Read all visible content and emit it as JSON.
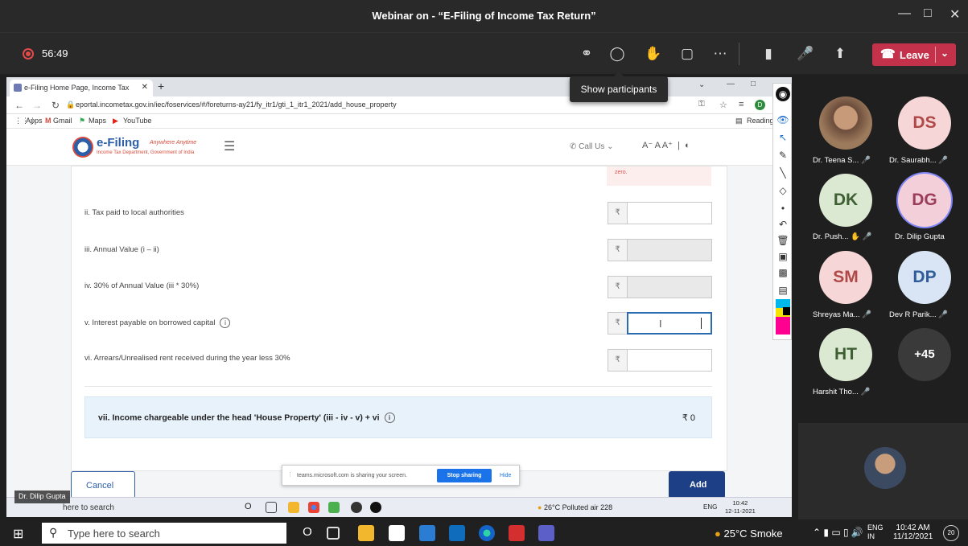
{
  "teams": {
    "window_title": "Webinar on - “E-Filing of Income Tax Return”",
    "timer": "56:49",
    "tooltip": "Show participants",
    "leave_label": "Leave",
    "icons": [
      "participants-icon",
      "chat-icon",
      "raise-hand-icon",
      "rooms-icon",
      "more-icon",
      "camera-off-icon",
      "mic-off-icon",
      "share-icon"
    ]
  },
  "browser": {
    "tab_title": "e-Filing Home Page, Income Tax",
    "url": "eportal.incometax.gov.in/iec/foservices/#/foreturns-ay21/fy_itr1/gti_1_itr1_2021/add_house_property",
    "bookmarks": [
      "Apps",
      "Gmail",
      "Maps",
      "YouTube"
    ],
    "reading": "Reading",
    "profile_initial": "D"
  },
  "site": {
    "logo_title": "e-Filing",
    "logo_tag": "Anywhere Anytime",
    "logo_sub": "Income Tax Department, Government of India",
    "call_us": "Call Us",
    "font_tools": "A⁻  A  A⁺"
  },
  "form": {
    "note": "zero.",
    "rows": [
      {
        "label": "ii. Tax paid to local authorities",
        "rupee": "₹",
        "state": "enabled"
      },
      {
        "label": "iii. Annual Value (i – ii)",
        "rupee": "₹",
        "state": "disabled"
      },
      {
        "label": "iv. 30% of Annual Value (iii * 30%)",
        "rupee": "₹",
        "state": "disabled"
      },
      {
        "label": "v. Interest payable on borrowed capital",
        "rupee": "₹",
        "state": "focused"
      },
      {
        "label": "vi. Arrears/Unrealised rent received during the year less 30%",
        "rupee": "₹",
        "state": "enabled"
      }
    ],
    "total_label": "vii. Income chargeable under the head 'House Property' (iii - iv - v) + vi",
    "total_value": "₹ 0",
    "cancel_label": "Cancel",
    "add_label": "Add"
  },
  "share_bar": {
    "message": "teams.microsoft.com is sharing your screen.",
    "stop_label": "Stop sharing",
    "hide_label": "Hide"
  },
  "inner_taskbar": {
    "presenter": "Dr. Dilip Gupta",
    "search": "here to search",
    "weather": "26°C  Polluted air 228",
    "lang": "ENG",
    "time": "10:42",
    "date": "12-11-2021"
  },
  "participants": [
    {
      "initials": "",
      "name": "Dr. Teena S...",
      "bg": "#7a5c4e",
      "fg": "#ffffff",
      "photo": true
    },
    {
      "initials": "DS",
      "name": "Dr. Saurabh...",
      "bg": "#f6d6d6",
      "fg": "#b04848"
    },
    {
      "initials": "DK",
      "name": "Dr. Push...",
      "bg": "#dbe8d2",
      "fg": "#3d5f32"
    },
    {
      "initials": "DG",
      "name": "Dr. Dilip Gupta",
      "bg": "#f3d0d9",
      "fg": "#9b3c58",
      "speaking": true
    },
    {
      "initials": "SM",
      "name": "Shreyas Ma...",
      "bg": "#f6d6d6",
      "fg": "#b04848"
    },
    {
      "initials": "DP",
      "name": "Dev R Parik...",
      "bg": "#d9e5f5",
      "fg": "#2f5d9a"
    },
    {
      "initials": "HT",
      "name": "Harshit Tho...",
      "bg": "#dbe8d2",
      "fg": "#3d5f32"
    },
    {
      "initials": "+45",
      "name": "",
      "bg": "#3a3a3a",
      "fg": "#ffffff"
    }
  ],
  "taskbar": {
    "search_placeholder": "Type here to search",
    "weather": "25°C  Smoke",
    "lang": "ENG",
    "region": "IN",
    "time": "10:42 AM",
    "date": "11/12/2021",
    "notifications": "20"
  }
}
